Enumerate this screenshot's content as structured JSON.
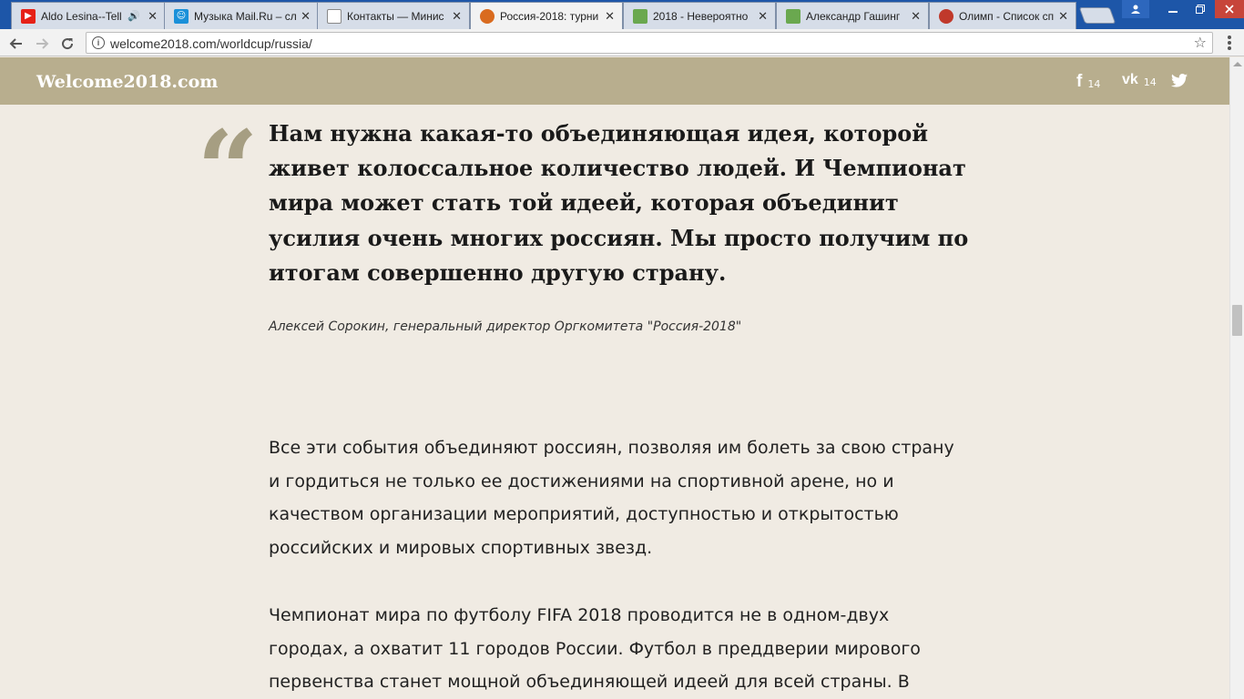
{
  "browser": {
    "tabs": [
      {
        "title": "Aldo Lesina--Tell",
        "favicon_color": "#e62117",
        "favicon_glyph": "▶",
        "audio": "🔊",
        "active": false
      },
      {
        "title": "Музыка Mail.Ru – сл",
        "favicon_color": "#1a90d9",
        "favicon_glyph": "☺",
        "active": false
      },
      {
        "title": "Контакты — Минис",
        "favicon_color": "#ffffff",
        "favicon_glyph": "▯",
        "active": false
      },
      {
        "title": "Россия-2018: турни",
        "favicon_color": "#d96b1f",
        "favicon_glyph": "◉",
        "active": true
      },
      {
        "title": "2018 - Невероятно",
        "favicon_color": "#6aa84f",
        "favicon_glyph": "",
        "active": false
      },
      {
        "title": "Александр Гашинг",
        "favicon_color": "#6aa84f",
        "favicon_glyph": "",
        "active": false
      },
      {
        "title": "Олимп - Список сп",
        "favicon_color": "#c0392b",
        "favicon_glyph": "✪",
        "active": false
      }
    ],
    "close_glyph": "✕",
    "address": "welcome2018.com/worldcup/russia/"
  },
  "site": {
    "logo": "Welcome2018.com",
    "share": [
      {
        "icon": "facebook-icon",
        "glyph": "f",
        "count": "14"
      },
      {
        "icon": "vk-icon",
        "glyph": "vk",
        "count": "14"
      },
      {
        "icon": "twitter-icon",
        "glyph": "🐦",
        "count": ""
      }
    ]
  },
  "article": {
    "quote_mark": "“",
    "quote": "Нам нужна какая-то объединяющая идея, которой живет колоссальное количество людей. И Чемпионат мира может стать той идеей, которая объединит усилия очень многих россиян. Мы просто получим по итогам совершенно другую страну.",
    "quote_author": "Алексей Сорокин, генеральный директор Оргкомитета \"Россия-2018\"",
    "paragraphs": [
      "Все эти события объединяют россиян, позволяя им болеть за свою страну и гордиться не только ее достижениями на спортивной арене, но и качеством организации мероприятий, доступностью и открытостью российских и мировых спортивных звезд.",
      "Чемпионат мира по футболу FIFA 2018 проводится не в одном-двух городах, а охватит 11 городов России. Футбол в преддверии мирового первенства станет мощной объединяющей идеей для всей страны. В"
    ]
  }
}
